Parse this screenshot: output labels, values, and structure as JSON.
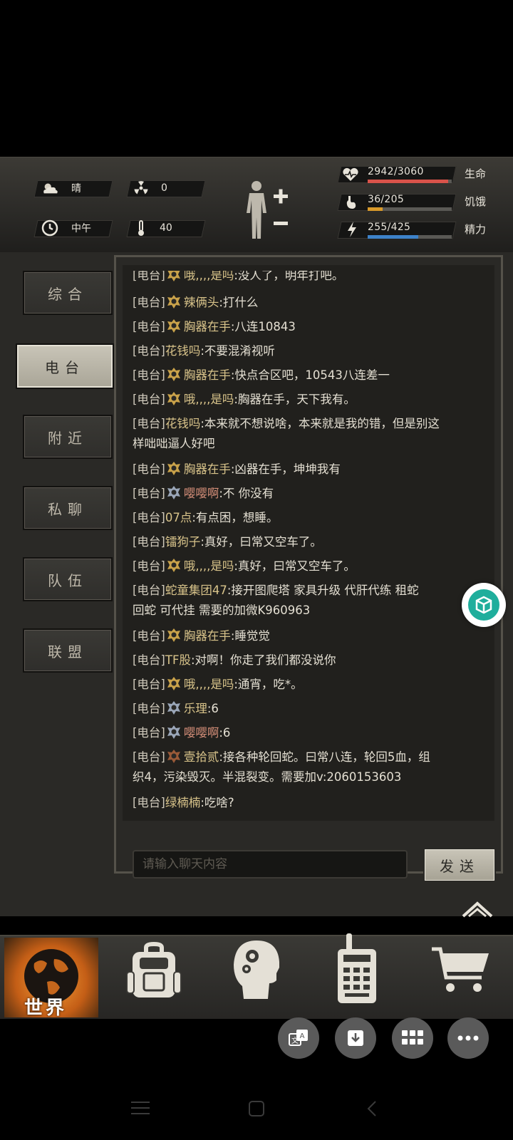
{
  "status": {
    "weather": {
      "label": "晴",
      "icon": "sun-cloud-icon"
    },
    "radiation": {
      "value": "0",
      "icon": "radiation-icon"
    },
    "time": {
      "label": "中午",
      "icon": "clock-icon"
    },
    "temperature": {
      "value": "40",
      "icon": "thermometer-icon"
    },
    "health": {
      "text": "2942/3060",
      "label": "生命",
      "fraction": 0.9614,
      "color": "#d9534a"
    },
    "hunger": {
      "text": "36/205",
      "label": "饥饿",
      "fraction": 0.1756,
      "color": "#d99a2a"
    },
    "energy": {
      "text": "255/425",
      "label": "精力",
      "fraction": 0.6,
      "color": "#3d82c9"
    }
  },
  "tabs": [
    {
      "label": "综合"
    },
    {
      "label": "电台"
    },
    {
      "label": "附近"
    },
    {
      "label": "私聊"
    },
    {
      "label": "队伍"
    },
    {
      "label": "联盟"
    }
  ],
  "active_tab": "电台",
  "messages": [
    {
      "channel": "[电台]",
      "icon": "gold",
      "name": "哦,,,,是吗",
      "text": ":没人了，明年打吧。"
    },
    {
      "channel": "[电台]",
      "icon": "gold",
      "name": "辣俩头",
      "text": ":打什么"
    },
    {
      "channel": "[电台]",
      "icon": "gold",
      "name": "胸器在手",
      "text": ":八连10843"
    },
    {
      "channel": "[电台]",
      "icon": "",
      "name": "花钱吗",
      "text": ":不要混淆视听"
    },
    {
      "channel": "[电台]",
      "icon": "gold",
      "name": "胸器在手",
      "text": ":快点合区吧，10543八连差一"
    },
    {
      "channel": "[电台]",
      "icon": "gold",
      "name": "哦,,,,是吗",
      "text": ":胸器在手，天下我有。"
    },
    {
      "channel": "[电台]",
      "icon": "",
      "name": "花钱吗",
      "text": ":本来就不想说啥，本来就是我的错，但是别这",
      "cont": "样咄咄逼人好吧"
    },
    {
      "channel": "[电台]",
      "icon": "gold",
      "name": "胸器在手",
      "text": ":凶器在手，坤坤我有"
    },
    {
      "channel": "[电台]",
      "icon": "silver",
      "name": "嘤嘤啊",
      "text": ":不 你没有",
      "pink": true
    },
    {
      "channel": "[电台]",
      "icon": "",
      "name": "07点",
      "text": ":有点困，想睡。"
    },
    {
      "channel": "[电台]",
      "icon": "",
      "name": "镭狗子",
      "text": ":真好，曰常又空车了。"
    },
    {
      "channel": "[电台]",
      "icon": "gold",
      "name": "哦,,,,是吗",
      "text": ":真好，曰常又空车了。"
    },
    {
      "channel": "[电台]",
      "icon": "",
      "name": "蛇童集团47",
      "text": ":接开图爬塔 家具升级 代肝代练 租蛇",
      "cont": "回蛇 可代挂 需要的加微K960963"
    },
    {
      "channel": "[电台]",
      "icon": "gold",
      "name": "胸器在手",
      "text": ":睡觉觉"
    },
    {
      "channel": "[电台]",
      "icon": "",
      "name": "TF股",
      "text": ":对啊！你走了我们都没说你"
    },
    {
      "channel": "[电台]",
      "icon": "gold",
      "name": "哦,,,,是吗",
      "text": ":通宵，吃*。"
    },
    {
      "channel": "[电台]",
      "icon": "silver",
      "name": "乐理",
      "text": ":6"
    },
    {
      "channel": "[电台]",
      "icon": "silver",
      "name": "嘤嘤啊",
      "text": ":6",
      "pink": true
    },
    {
      "channel": "[电台]",
      "icon": "bronze",
      "name": "壹拾贰",
      "text": ":接各种轮回蛇。曰常八连，轮回5血，组",
      "cont": "织4，污染毁灭。半混裂变。需要加v:2060153603"
    },
    {
      "channel": "[电台]",
      "icon": "",
      "name": "绿楠楠",
      "text": ":吃啥?"
    }
  ],
  "chat_input": {
    "placeholder": "请输入聊天内容"
  },
  "send_label": "发送",
  "bottom_nav": [
    {
      "label": "世界",
      "icon": "globe-icon"
    },
    {
      "label": "",
      "icon": "backpack-icon"
    },
    {
      "label": "",
      "icon": "head-gears-icon"
    },
    {
      "label": "",
      "icon": "walkie-talkie-icon"
    },
    {
      "label": "",
      "icon": "shopping-cart-icon"
    }
  ],
  "floating_buttons": [
    "translate-icon",
    "download-icon",
    "grid-icon",
    "more-icon"
  ]
}
